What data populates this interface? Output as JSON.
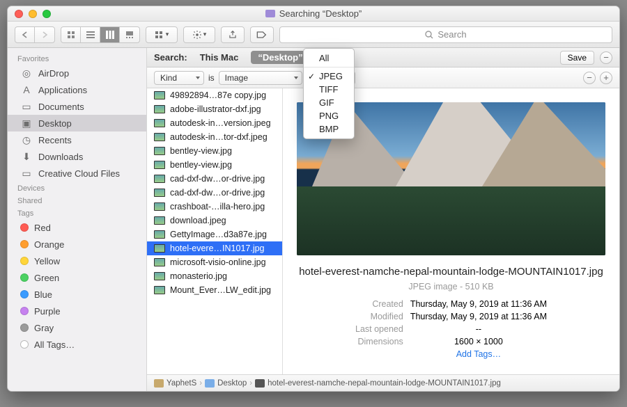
{
  "window": {
    "title": "Searching “Desktop”"
  },
  "toolbar": {
    "search_placeholder": "Search"
  },
  "sidebar": {
    "sections": [
      {
        "header": "Favorites",
        "items": [
          {
            "label": "AirDrop",
            "icon": "airdrop-icon"
          },
          {
            "label": "Applications",
            "icon": "applications-icon"
          },
          {
            "label": "Documents",
            "icon": "documents-icon"
          },
          {
            "label": "Desktop",
            "icon": "desktop-icon",
            "selected": true
          },
          {
            "label": "Recents",
            "icon": "recents-icon"
          },
          {
            "label": "Downloads",
            "icon": "downloads-icon"
          },
          {
            "label": "Creative Cloud Files",
            "icon": "folder-icon"
          }
        ]
      },
      {
        "header": "Devices",
        "items": []
      },
      {
        "header": "Shared",
        "items": []
      },
      {
        "header": "Tags",
        "items": [
          {
            "label": "Red",
            "color": "#ff5b53"
          },
          {
            "label": "Orange",
            "color": "#ff9e2f"
          },
          {
            "label": "Yellow",
            "color": "#ffd53a"
          },
          {
            "label": "Green",
            "color": "#4bd162"
          },
          {
            "label": "Blue",
            "color": "#3a9bff"
          },
          {
            "label": "Purple",
            "color": "#c682ef"
          },
          {
            "label": "Gray",
            "color": "#9b9b9b"
          },
          {
            "label": "All Tags…",
            "color": "#e3e3e3"
          }
        ]
      }
    ]
  },
  "scopebar": {
    "label": "Search:",
    "options": [
      "This Mac",
      "“Desktop”"
    ],
    "active_index": 1,
    "save": "Save"
  },
  "rule": {
    "attribute": "Kind",
    "relation": "is",
    "value": "Image"
  },
  "kind_menu": {
    "items": [
      "All",
      "JPEG",
      "TIFF",
      "GIF",
      "PNG",
      "BMP"
    ],
    "checked_index": 1
  },
  "file_list": [
    {
      "name": "49892894…87e copy.jpg"
    },
    {
      "name": "adobe-illustrator-dxf.jpg"
    },
    {
      "name": "autodesk-in…version.jpeg"
    },
    {
      "name": "autodesk-in…tor-dxf.jpeg"
    },
    {
      "name": "bentley-view.jpg"
    },
    {
      "name": "bentley-view.jpg"
    },
    {
      "name": "cad-dxf-dw…or-drive.jpg"
    },
    {
      "name": "cad-dxf-dw…or-drive.jpg"
    },
    {
      "name": "crashboat-…illa-hero.jpg"
    },
    {
      "name": "download.jpeg"
    },
    {
      "name": "GettyImage…d3a87e.jpg"
    },
    {
      "name": "hotel-evere…IN1017.jpg",
      "selected": true
    },
    {
      "name": "microsoft-visio-online.jpg"
    },
    {
      "name": "monasterio.jpg"
    },
    {
      "name": "Mount_Ever…LW_edit.jpg"
    }
  ],
  "preview": {
    "filename": "hotel-everest-namche-nepal-mountain-lodge-MOUNTAIN1017.jpg",
    "filetype": "JPEG image - 510 KB",
    "rows": [
      {
        "label": "Created",
        "value": "Thursday, May 9, 2019 at 11:36 AM"
      },
      {
        "label": "Modified",
        "value": "Thursday, May 9, 2019 at 11:36 AM"
      },
      {
        "label": "Last opened",
        "value": "--"
      },
      {
        "label": "Dimensions",
        "value": "1600 × 1000"
      }
    ],
    "add_tags": "Add Tags…"
  },
  "pathbar": {
    "crumbs": [
      "YaphetS",
      "Desktop",
      "hotel-everest-namche-nepal-mountain-lodge-MOUNTAIN1017.jpg"
    ]
  }
}
